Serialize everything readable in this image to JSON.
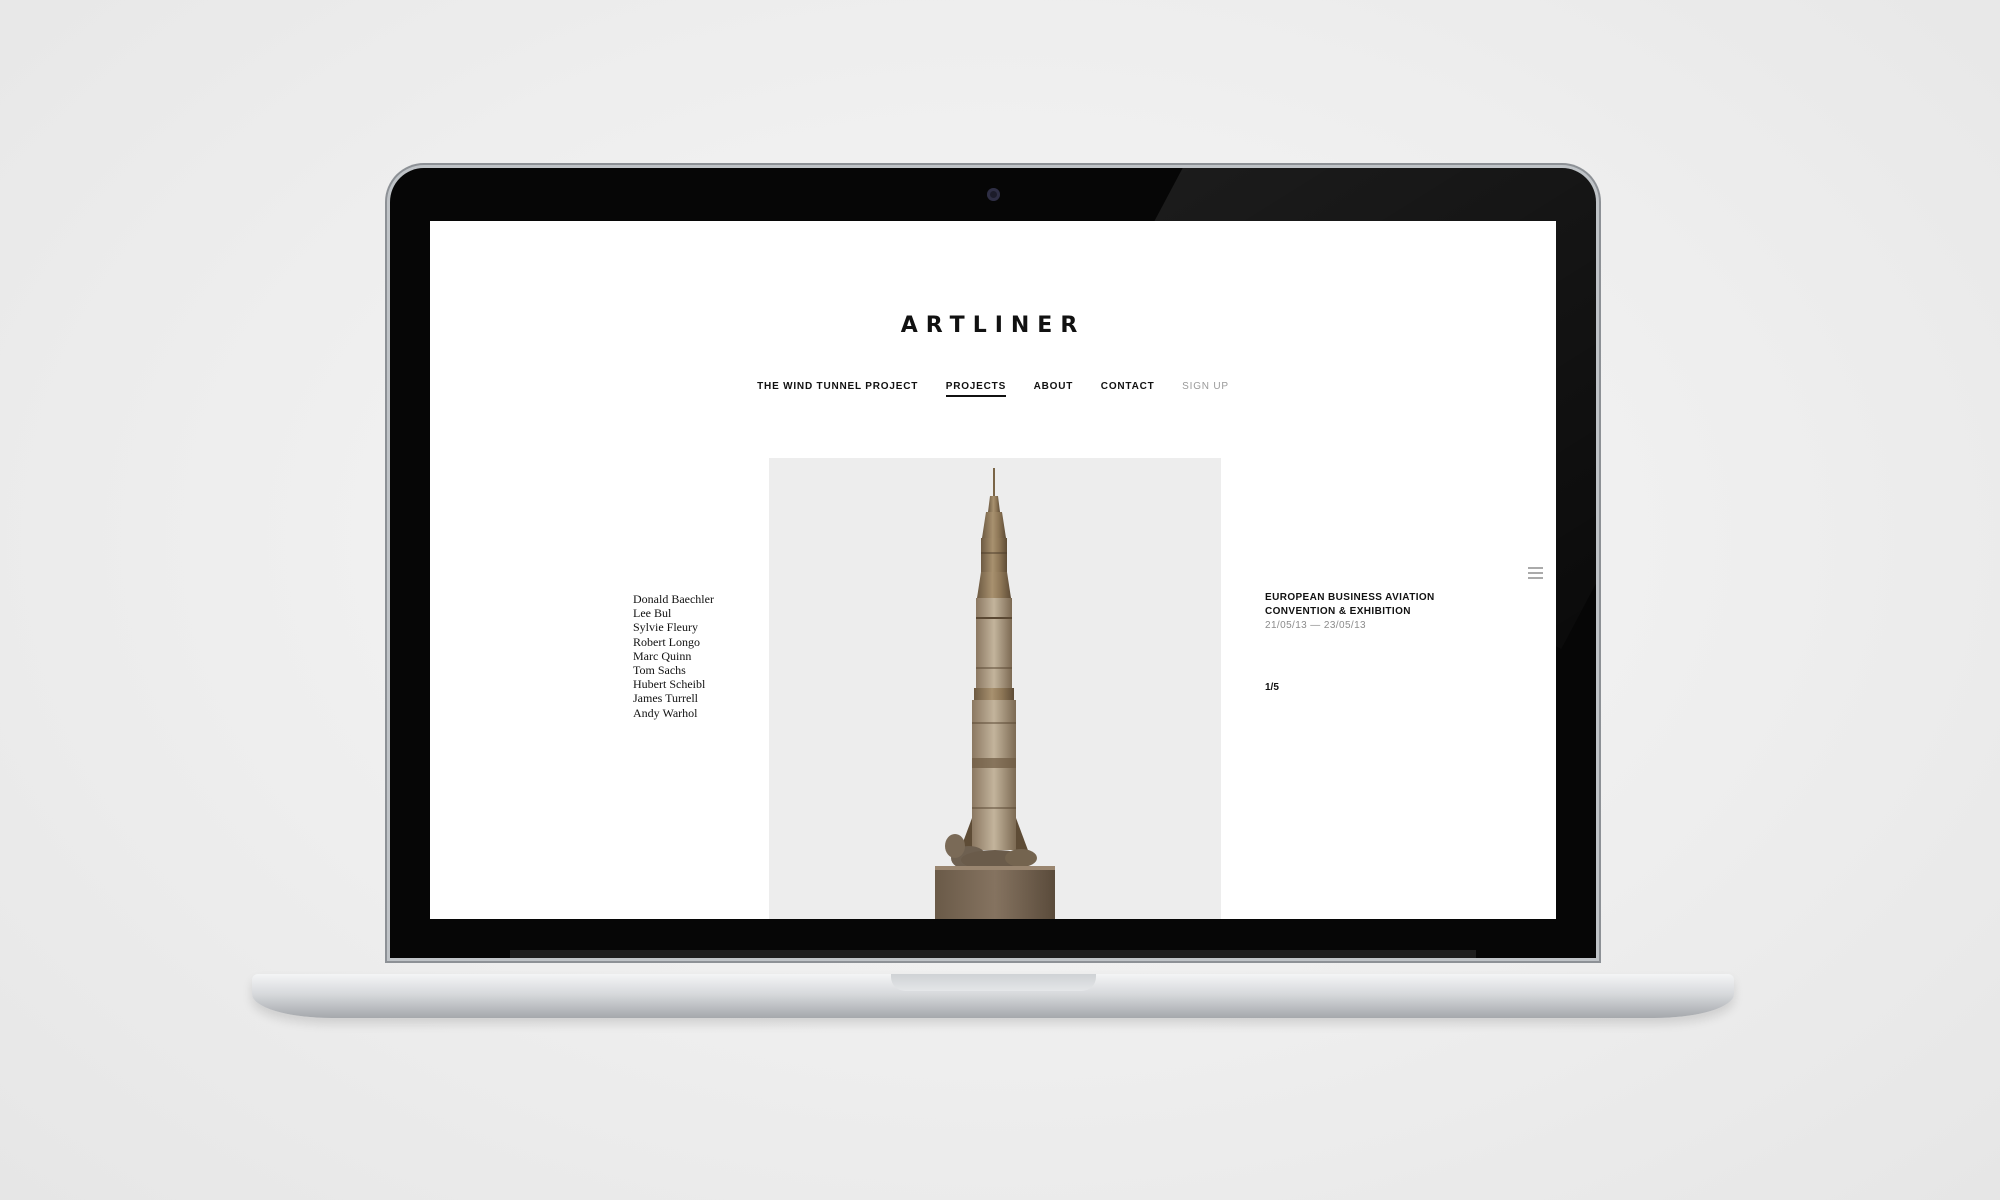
{
  "site": {
    "logo": "ARTLINER"
  },
  "nav": {
    "items": [
      {
        "label": "THE WIND TUNNEL PROJECT"
      },
      {
        "label": "PROJECTS"
      },
      {
        "label": "ABOUT"
      },
      {
        "label": "CONTACT"
      },
      {
        "label": "SIGN UP"
      }
    ],
    "active": "PROJECTS"
  },
  "artists": [
    "Donald Baechler",
    "Lee Bul",
    "Sylvie Fleury",
    "Robert Longo",
    "Marc Quinn",
    "Tom Sachs",
    "Hubert Scheibl",
    "James Turrell",
    "Andy Warhol"
  ],
  "event": {
    "title_line1": "EUROPEAN BUSINESS AVIATION",
    "title_line2": "CONVENTION & EXHIBITION",
    "dates": "21/05/13 — 23/05/13"
  },
  "pager": {
    "counter": "1/5"
  },
  "icons": {
    "menu": "hamburger-icon",
    "artwork": "rocket-sculpture"
  },
  "colors": {
    "background": "#ffffff",
    "text": "#111111",
    "muted": "#9a9a9a",
    "artwork_bg": "#ededed",
    "bronze": "#8a7559"
  }
}
